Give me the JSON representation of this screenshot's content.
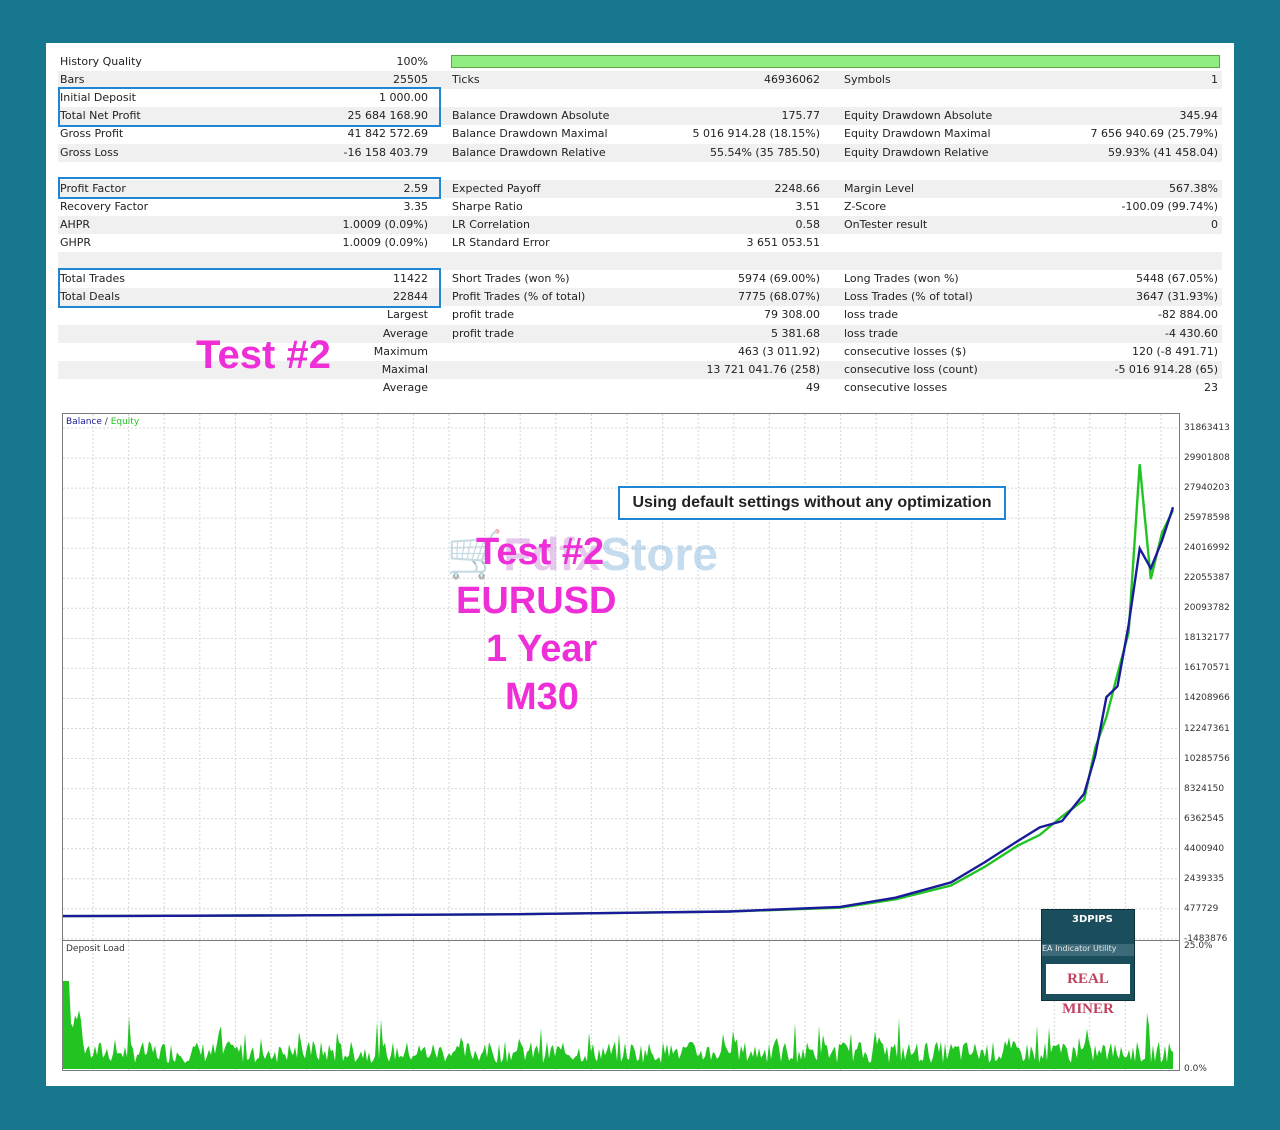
{
  "stats": {
    "rows": [
      [
        [
          "History Quality",
          "100%"
        ],
        null,
        null
      ],
      [
        [
          "Bars",
          "25505"
        ],
        [
          "Ticks",
          "46936062"
        ],
        [
          "Symbols",
          "1"
        ]
      ],
      [
        [
          "Initial Deposit",
          "1 000.00"
        ],
        null,
        null
      ],
      [
        [
          "Total Net Profit",
          "25 684 168.90"
        ],
        [
          "Balance Drawdown Absolute",
          "175.77"
        ],
        [
          "Equity Drawdown Absolute",
          "345.94"
        ]
      ],
      [
        [
          "Gross Profit",
          "41 842 572.69"
        ],
        [
          "Balance Drawdown Maximal",
          "5 016 914.28 (18.15%)"
        ],
        [
          "Equity Drawdown Maximal",
          "7 656 940.69 (25.79%)"
        ]
      ],
      [
        [
          "Gross Loss",
          "-16 158 403.79"
        ],
        [
          "Balance Drawdown Relative",
          "55.54% (35 785.50)"
        ],
        [
          "Equity Drawdown Relative",
          "59.93% (41 458.04)"
        ]
      ],
      [
        null,
        null,
        null
      ],
      [
        [
          "Profit Factor",
          "2.59"
        ],
        [
          "Expected Payoff",
          "2248.66"
        ],
        [
          "Margin Level",
          "567.38%"
        ]
      ],
      [
        [
          "Recovery Factor",
          "3.35"
        ],
        [
          "Sharpe Ratio",
          "3.51"
        ],
        [
          "Z-Score",
          "-100.09 (99.74%)"
        ]
      ],
      [
        [
          "AHPR",
          "1.0009 (0.09%)"
        ],
        [
          "LR Correlation",
          "0.58"
        ],
        [
          "OnTester result",
          "0"
        ]
      ],
      [
        [
          "GHPR",
          "1.0009 (0.09%)"
        ],
        [
          "LR Standard Error",
          "3 651 053.51"
        ],
        null
      ],
      [
        null,
        null,
        null
      ],
      [
        [
          "Total Trades",
          "11422"
        ],
        [
          "Short Trades (won %)",
          "5974 (69.00%)"
        ],
        [
          "Long Trades (won %)",
          "5448 (67.05%)"
        ]
      ],
      [
        [
          "Total Deals",
          "22844"
        ],
        [
          "Profit Trades (% of total)",
          "7775 (68.07%)"
        ],
        [
          "Loss Trades (% of total)",
          "3647 (31.93%)"
        ]
      ],
      [
        [
          "",
          "Largest"
        ],
        [
          "profit trade",
          "79 308.00"
        ],
        [
          "loss trade",
          "-82 884.00"
        ]
      ],
      [
        [
          "",
          "Average"
        ],
        [
          "profit trade",
          "5 381.68"
        ],
        [
          "loss trade",
          "-4 430.60"
        ]
      ],
      [
        [
          "",
          "Maximum"
        ],
        [
          "",
          "463 (3 011.92)"
        ],
        [
          "consecutive losses ($)",
          "120 (-8 491.71)"
        ]
      ],
      [
        [
          "",
          "Maximal"
        ],
        [
          "",
          "13 721 041.76 (258)"
        ],
        [
          "consecutive loss (count)",
          "-5 016 914.28 (65)"
        ]
      ],
      [
        [
          "",
          "Average"
        ],
        [
          "",
          "49"
        ],
        [
          "consecutive losses",
          "23"
        ]
      ]
    ],
    "history_quality_fraction": 1.0
  },
  "overlay": {
    "test_label": "Test #2",
    "note": "Using default settings without any optimization",
    "lines": [
      "Test #2",
      "EURUSD",
      "1 Year",
      "M30"
    ],
    "watermark_a": "Fdfx",
    "watermark_b": "Store",
    "logo_top": "3DPIPS",
    "logo_mid": "EA  Indicator  Utility",
    "logo_main": "REAL MINER"
  },
  "colors": {
    "frame": "#16778f",
    "accent_pink": "#ee2fd8",
    "highlight_blue": "#1f86d6",
    "balance": "#1a1a9a",
    "equity": "#22c422",
    "load": "#22c422",
    "quality_bar": "#90ee80"
  },
  "chart_data": [
    {
      "type": "line",
      "legend": [
        "Balance",
        "Equity"
      ],
      "y_ticks": [
        "31863413",
        "29901808",
        "27940203",
        "25978598",
        "24016992",
        "22055387",
        "20093782",
        "18132177",
        "16170571",
        "14208966",
        "12247361",
        "10285756",
        "8324150",
        "6362545",
        "4400940",
        "2439335",
        "477729",
        "-1483876"
      ],
      "ylim": [
        -1483876,
        31863413
      ],
      "grid": true,
      "series": [
        {
          "name": "Balance",
          "x": [
            0,
            0.2,
            0.4,
            0.6,
            0.7,
            0.75,
            0.8,
            0.83,
            0.86,
            0.88,
            0.9,
            0.92,
            0.93,
            0.94,
            0.95,
            0.96,
            0.97,
            0.98,
            0.99,
            1.0
          ],
          "values": [
            1000,
            50000,
            120000,
            300000,
            600000,
            1200000,
            2200000,
            3500000,
            4900000,
            5800000,
            6200000,
            8000000,
            10500000,
            14300000,
            15000000,
            19000000,
            24000000,
            22700000,
            24500000,
            26685000
          ]
        },
        {
          "name": "Equity",
          "x": [
            0,
            0.2,
            0.4,
            0.6,
            0.7,
            0.75,
            0.8,
            0.83,
            0.86,
            0.88,
            0.9,
            0.92,
            0.93,
            0.94,
            0.95,
            0.96,
            0.97,
            0.98,
            0.99,
            1.0
          ],
          "values": [
            1000,
            50000,
            120000,
            300000,
            550000,
            1100000,
            2000000,
            3200000,
            4600000,
            5300000,
            6500000,
            7600000,
            11000000,
            13000000,
            15800000,
            18500000,
            29500000,
            22000000,
            25000000,
            26500000
          ]
        }
      ]
    },
    {
      "type": "bar",
      "legend": [
        "Deposit Load"
      ],
      "y_ticks": [
        "25.0%",
        "0.0%"
      ],
      "ylim": [
        0,
        25
      ],
      "grid": true
    }
  ]
}
